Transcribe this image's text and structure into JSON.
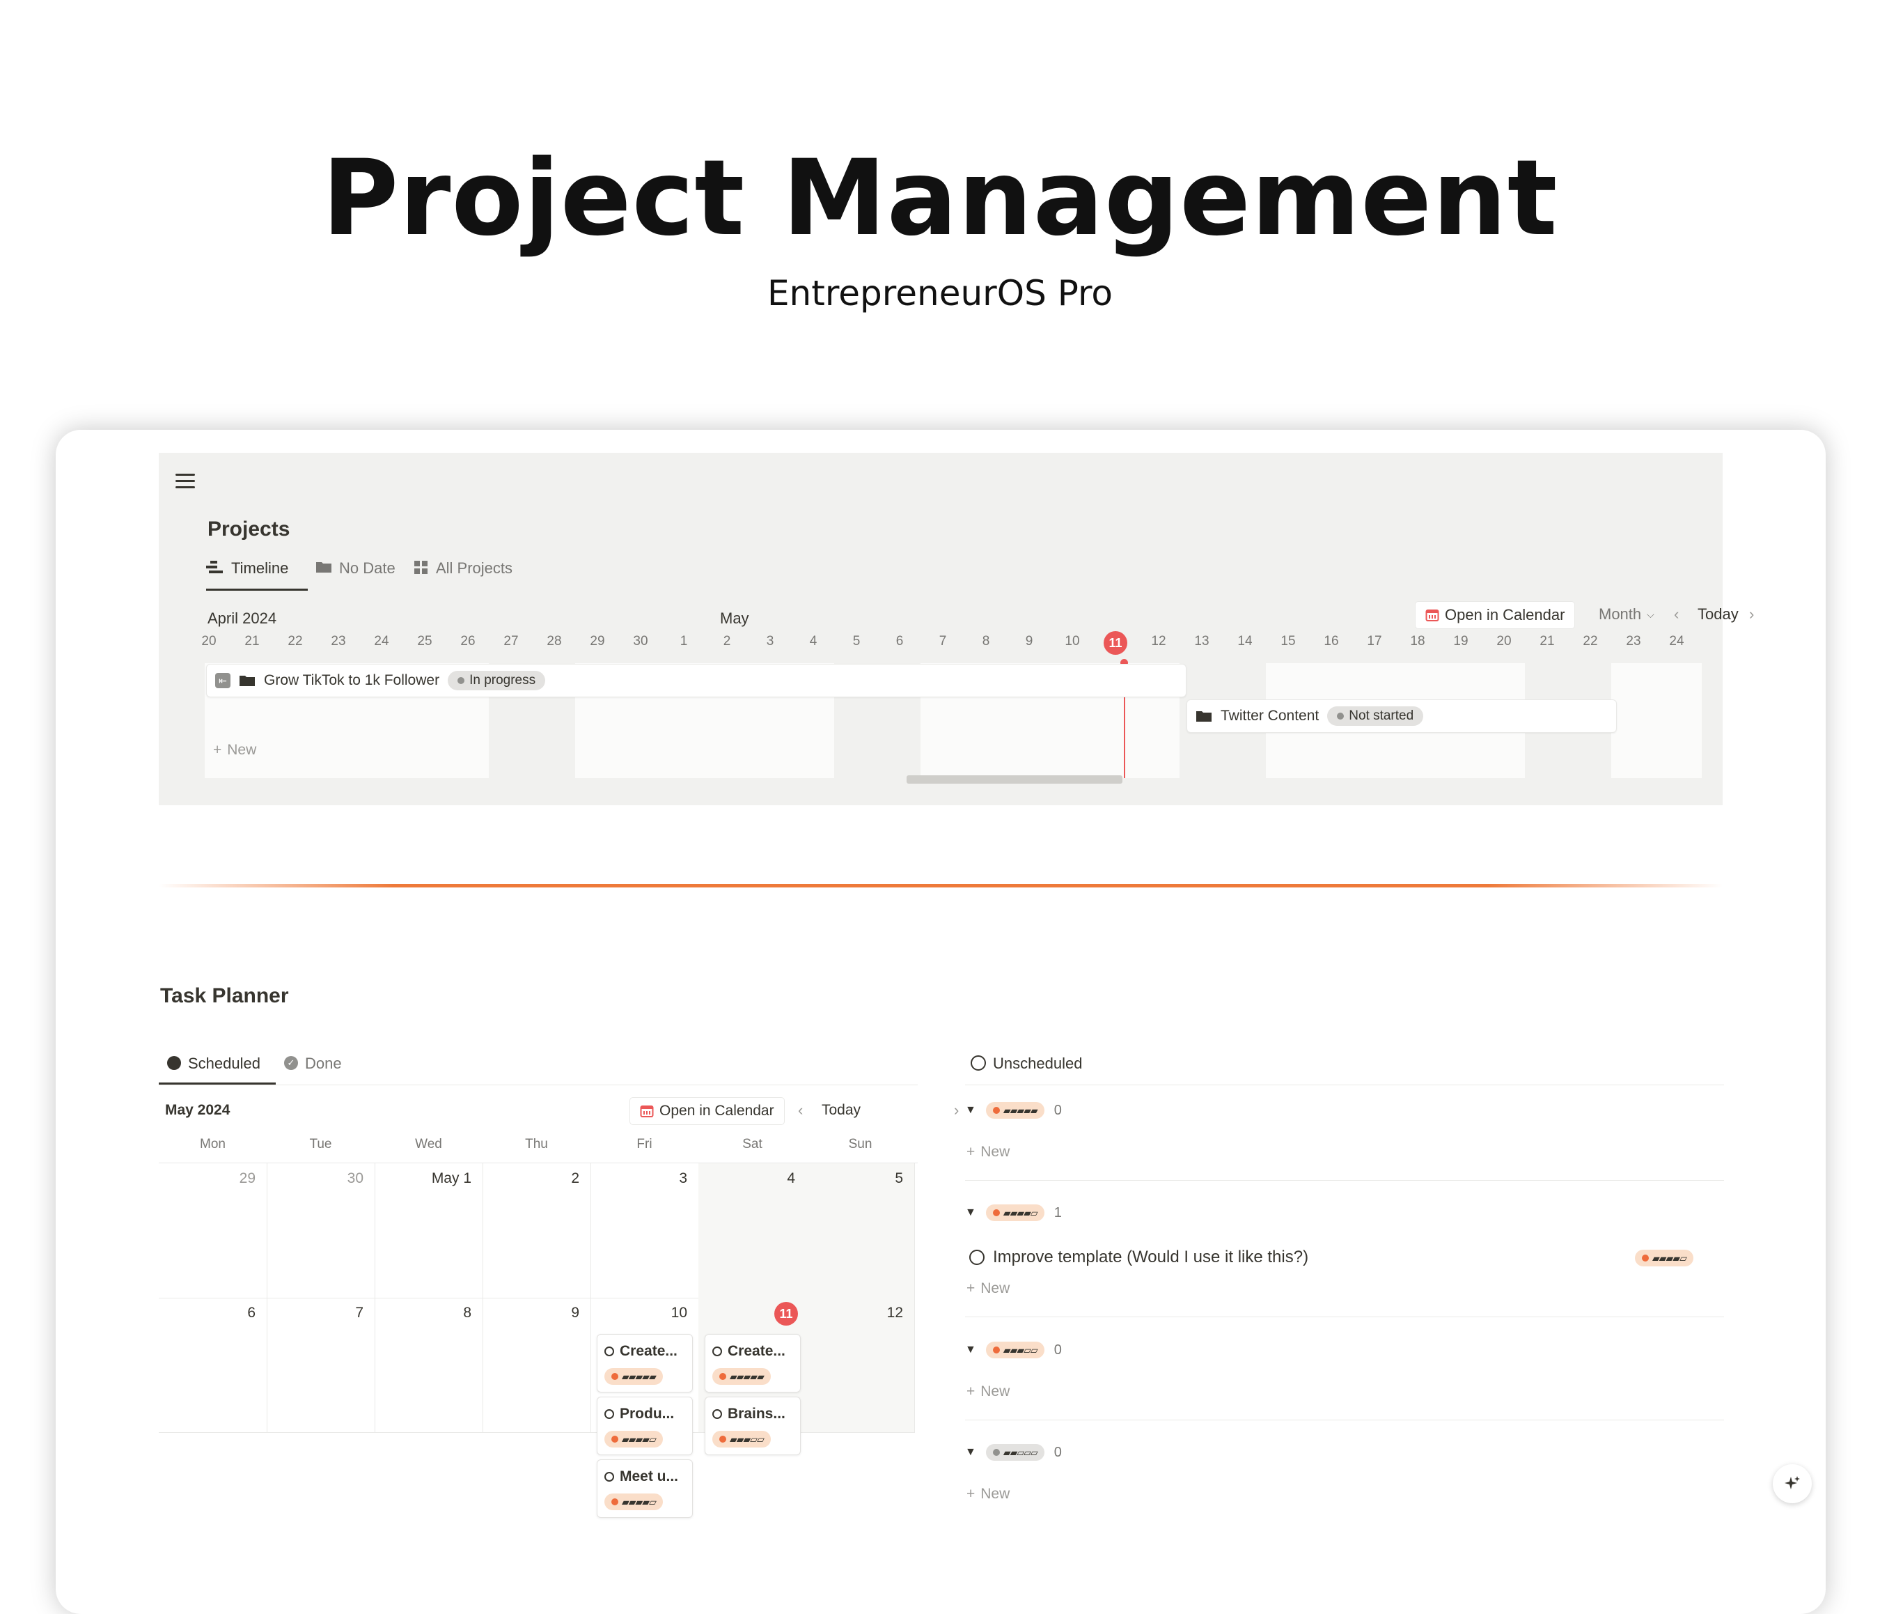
{
  "hero": {
    "title": "Project Management",
    "subtitle": "EntrepreneurOS Pro"
  },
  "projects": {
    "title": "Projects",
    "tabs": [
      {
        "label": "Timeline",
        "icon": "timeline-icon",
        "active": true
      },
      {
        "label": "No Date",
        "icon": "folder-icon",
        "active": false
      },
      {
        "label": "All Projects",
        "icon": "grid-icon",
        "active": false
      }
    ],
    "month_left": "April 2024",
    "month_mid": "May",
    "open_calendar": "Open in Calendar",
    "view_mode": "Month",
    "today_label": "Today",
    "days": [
      "20",
      "21",
      "22",
      "23",
      "24",
      "25",
      "26",
      "27",
      "28",
      "29",
      "30",
      "1",
      "2",
      "3",
      "4",
      "5",
      "6",
      "7",
      "8",
      "9",
      "10",
      "11",
      "12",
      "13",
      "14",
      "15",
      "16",
      "17",
      "18",
      "19",
      "20",
      "21",
      "22",
      "23",
      "24"
    ],
    "today_index": 21,
    "bars": [
      {
        "title": "Grow TikTok to 1k Follower",
        "status": "In progress"
      },
      {
        "title": "Twitter Content",
        "status": "Not started"
      }
    ],
    "new_label": "New"
  },
  "task_planner": {
    "title": "Task Planner",
    "tabs": [
      {
        "label": "Scheduled",
        "active": true
      },
      {
        "label": "Done",
        "active": false
      }
    ],
    "month": "May 2024",
    "open_calendar": "Open in Calendar",
    "today_label": "Today",
    "weekdays": [
      "Mon",
      "Tue",
      "Wed",
      "Thu",
      "Fri",
      "Sat",
      "Sun"
    ],
    "week1": [
      "29",
      "30",
      "May 1",
      "2",
      "3",
      "4",
      "5"
    ],
    "week2": [
      "6",
      "7",
      "8",
      "9",
      "10",
      "11",
      "12"
    ],
    "today_date": "11",
    "tasks_fri": [
      {
        "title": "Create...",
        "priority": "▰▰▰▰▰"
      },
      {
        "title": "Produ...",
        "priority": "▰▰▰▰▱"
      },
      {
        "title": "Meet u...",
        "priority": "▰▰▰▰▱"
      }
    ],
    "tasks_sat": [
      {
        "title": "Create...",
        "priority": "▰▰▰▰▰"
      },
      {
        "title": "Brains...",
        "priority": "▰▰▰▱▱"
      }
    ]
  },
  "unscheduled": {
    "label": "Unscheduled",
    "groups": [
      {
        "priority": "▰▰▰▰▰",
        "count": "0",
        "color": "orange"
      },
      {
        "priority": "▰▰▰▰▱",
        "count": "1",
        "color": "orange"
      },
      {
        "priority": "▰▰▰▱▱",
        "count": "0",
        "color": "orange"
      },
      {
        "priority": "▰▰▱▱▱",
        "count": "0",
        "color": "grey"
      }
    ],
    "item": {
      "title": "Improve template (Would I use it like this?)",
      "priority": "▰▰▰▰▱"
    },
    "new_label": "New"
  },
  "colors": {
    "accent": "#ee7a3a",
    "today": "#eb5757",
    "priority_bg": "#fadec9"
  }
}
